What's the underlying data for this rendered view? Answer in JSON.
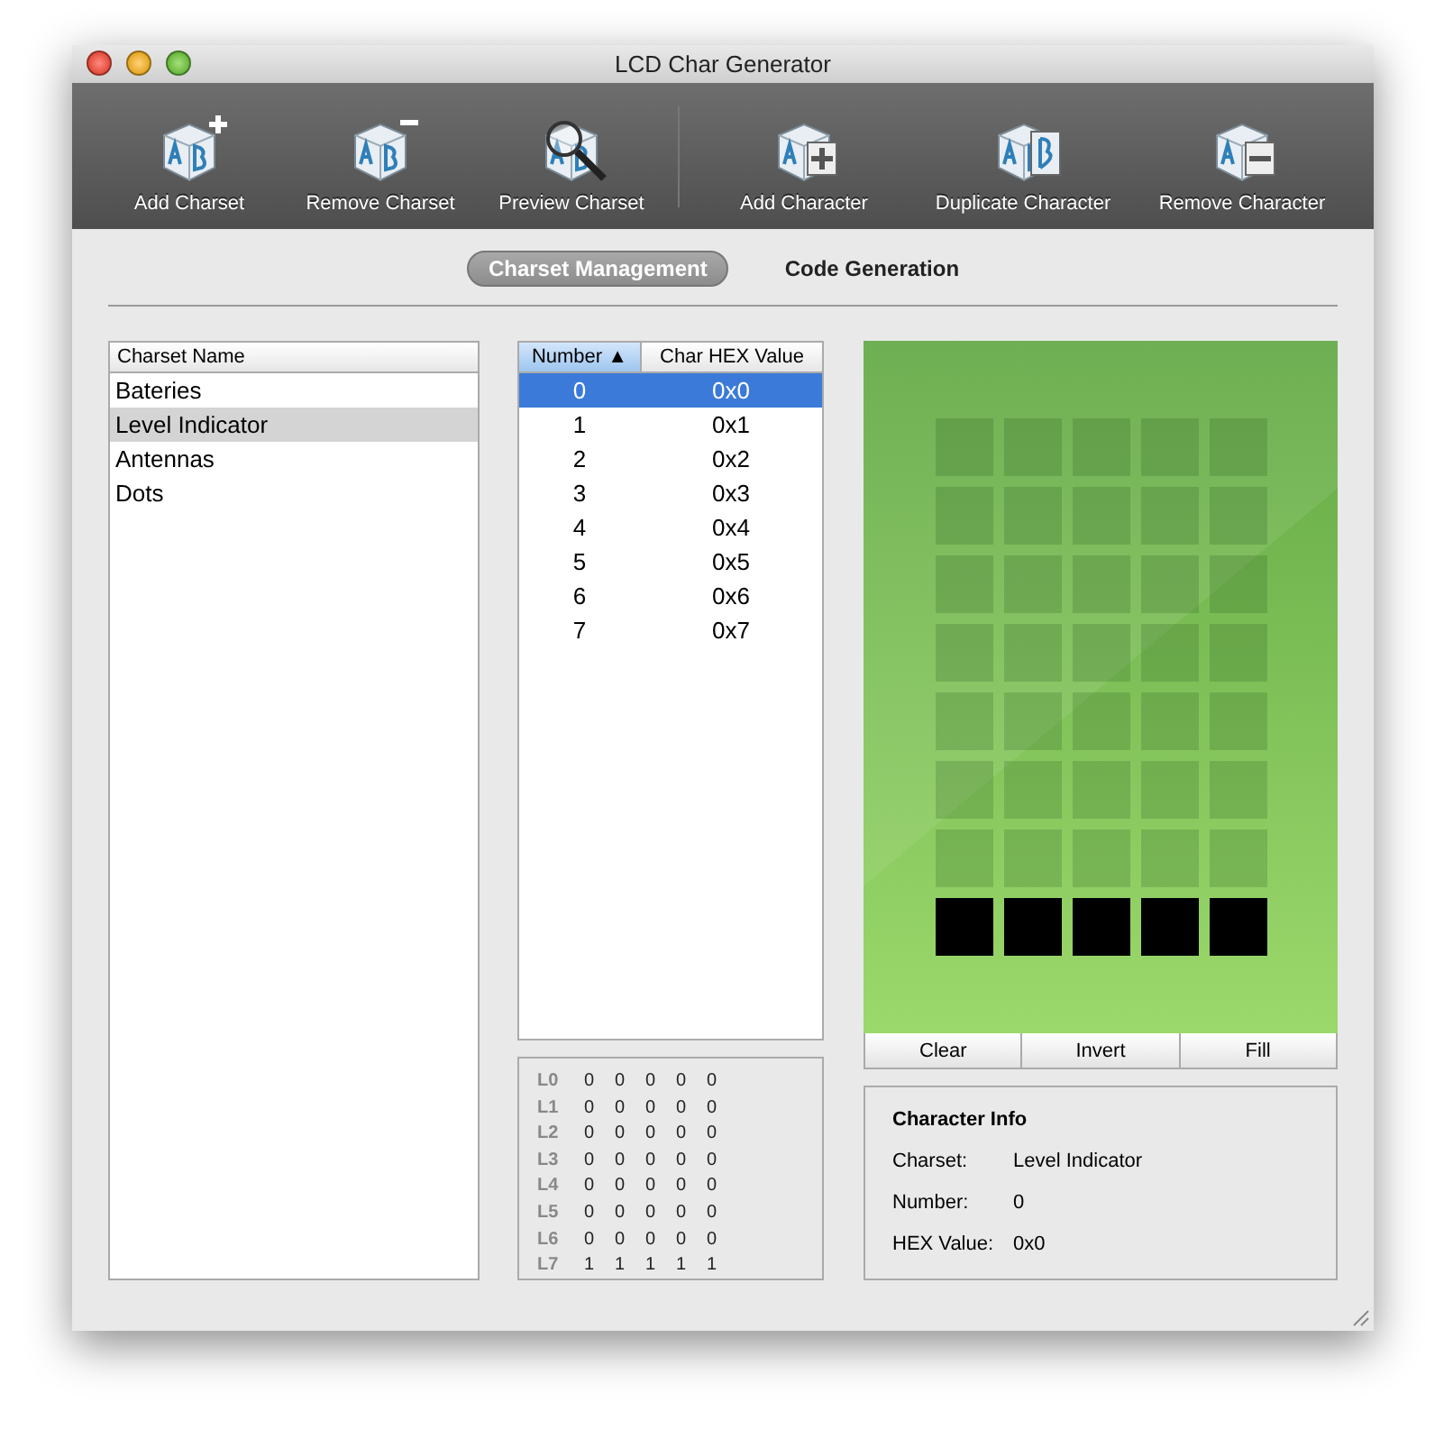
{
  "window": {
    "title": "LCD Char Generator"
  },
  "toolbar": [
    {
      "items": [
        {
          "label": "Add Charset",
          "kind": "add_set"
        },
        {
          "label": "Remove Charset",
          "kind": "remove_set"
        },
        {
          "label": "Preview Charset",
          "kind": "preview_set"
        }
      ]
    },
    {
      "items": [
        {
          "label": "Add Character",
          "kind": "add_char"
        },
        {
          "label": "Duplicate Character",
          "kind": "duplicate_char"
        },
        {
          "label": "Remove Character",
          "kind": "remove_char"
        }
      ]
    }
  ],
  "tabs": [
    {
      "label": "Charset Management",
      "selected": true
    },
    {
      "label": "Code Generation",
      "selected": false
    }
  ],
  "charsets": {
    "column": "Charset Name",
    "items": [
      {
        "name": "Bateries",
        "selected": false
      },
      {
        "name": "Level Indicator",
        "selected": true
      },
      {
        "name": "Antennas",
        "selected": false
      },
      {
        "name": "Dots",
        "selected": false
      }
    ]
  },
  "characters": {
    "columns": [
      "Number ▲",
      "Char HEX Value"
    ],
    "rows": [
      {
        "number": "0",
        "hex": "0x0",
        "selected": true
      },
      {
        "number": "1",
        "hex": "0x1",
        "selected": false
      },
      {
        "number": "2",
        "hex": "0x2",
        "selected": false
      },
      {
        "number": "3",
        "hex": "0x3",
        "selected": false
      },
      {
        "number": "4",
        "hex": "0x4",
        "selected": false
      },
      {
        "number": "5",
        "hex": "0x5",
        "selected": false
      },
      {
        "number": "6",
        "hex": "0x6",
        "selected": false
      },
      {
        "number": "7",
        "hex": "0x7",
        "selected": false
      }
    ]
  },
  "bit_rows": [
    {
      "label": "L0",
      "bits": [
        "0",
        "0",
        "0",
        "0",
        "0"
      ]
    },
    {
      "label": "L1",
      "bits": [
        "0",
        "0",
        "0",
        "0",
        "0"
      ]
    },
    {
      "label": "L2",
      "bits": [
        "0",
        "0",
        "0",
        "0",
        "0"
      ]
    },
    {
      "label": "L3",
      "bits": [
        "0",
        "0",
        "0",
        "0",
        "0"
      ]
    },
    {
      "label": "L4",
      "bits": [
        "0",
        "0",
        "0",
        "0",
        "0"
      ]
    },
    {
      "label": "L5",
      "bits": [
        "0",
        "0",
        "0",
        "0",
        "0"
      ]
    },
    {
      "label": "L6",
      "bits": [
        "0",
        "0",
        "0",
        "0",
        "0"
      ]
    },
    {
      "label": "L7",
      "bits": [
        "1",
        "1",
        "1",
        "1",
        "1"
      ]
    }
  ],
  "lcd_rows": [
    {
      "pixels": [
        false,
        false,
        false,
        false,
        false
      ]
    },
    {
      "pixels": [
        false,
        false,
        false,
        false,
        false
      ]
    },
    {
      "pixels": [
        false,
        false,
        false,
        false,
        false
      ]
    },
    {
      "pixels": [
        false,
        false,
        false,
        false,
        false
      ]
    },
    {
      "pixels": [
        false,
        false,
        false,
        false,
        false
      ]
    },
    {
      "pixels": [
        false,
        false,
        false,
        false,
        false
      ]
    },
    {
      "pixels": [
        false,
        false,
        false,
        false,
        false
      ]
    },
    {
      "pixels": [
        true,
        true,
        true,
        true,
        true
      ]
    }
  ],
  "lcd_buttons": [
    "Clear",
    "Invert",
    "Fill"
  ],
  "info": {
    "title": "Character Info",
    "fields": [
      {
        "label": "Charset:",
        "value": "Level Indicator"
      },
      {
        "label": "Number:",
        "value": "0"
      },
      {
        "label": "HEX Value:",
        "value": "0x0"
      }
    ]
  }
}
